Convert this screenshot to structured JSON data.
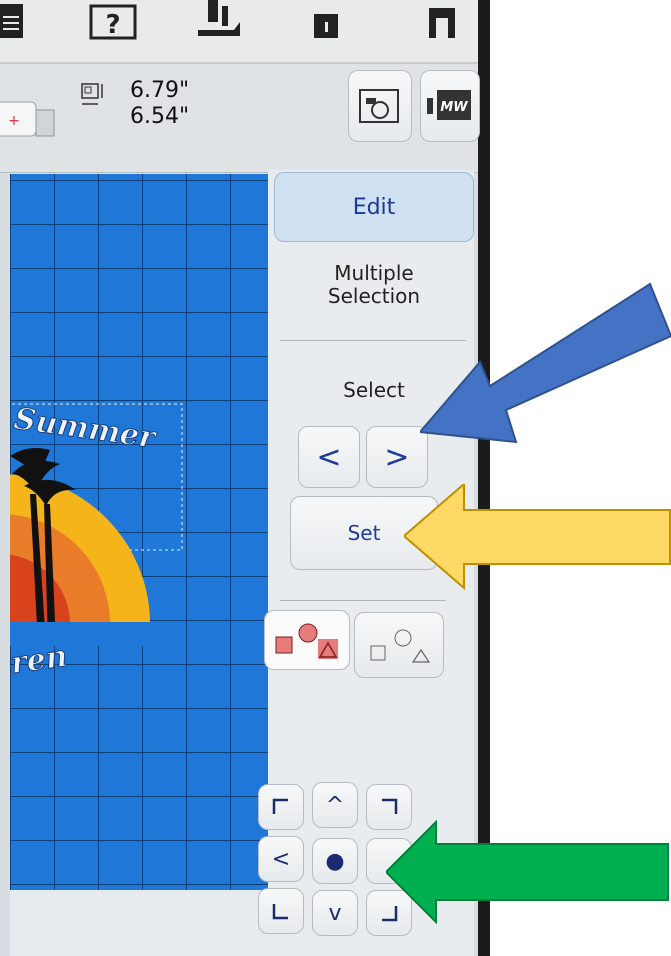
{
  "size": {
    "width_value": "6.79\"",
    "height_value": "6.54\""
  },
  "panel": {
    "edit_tab": "Edit",
    "multiple_selection": "Multiple\nSelection",
    "select_label": "Select",
    "prev": "<",
    "next": ">",
    "set_button": "Set"
  },
  "direction_pad": {
    "up": "^",
    "left": "<",
    "center": "●",
    "down": "v"
  },
  "design_text": {
    "top": "Summer",
    "bottom": "ren"
  },
  "annotation_colors": {
    "blue_arrow": "#4472c4",
    "yellow_arrow": "#ffd966",
    "green_arrow": "#00b050"
  }
}
